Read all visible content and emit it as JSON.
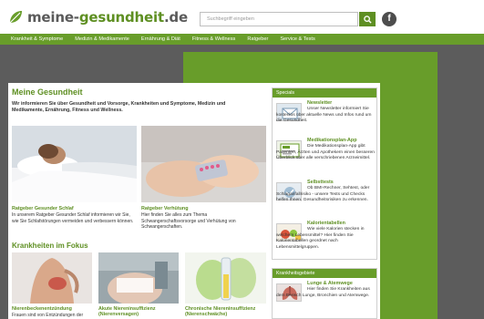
{
  "header": {
    "logo": {
      "prefix": "meine-",
      "highlight": "gesundheit",
      "suffix": ".de"
    },
    "search": {
      "placeholder": "Suchbegriff eingeben"
    },
    "search_icon": "search-icon",
    "social_icon": "facebook-icon",
    "social_label": "f"
  },
  "nav": {
    "items": [
      "Krankheit & Symptome",
      "Medizin & Medikamente",
      "Ernährung & Diät",
      "Fitness & Wellness",
      "Ratgeber",
      "Service & Tests"
    ]
  },
  "main": {
    "title": "Meine Gesundheit",
    "intro": "Wir informieren Sie über Gesundheit und Vorsorge, Krankheiten und Symptome, Medizin und Medikamente, Ernährung, Fitness und Wellness.",
    "cards": [
      {
        "title": "Ratgeber Gesunder Schlaf",
        "desc": "In unserem Ratgeber Gesunder Schlaf informieren wir Sie, wie Sie Schlafstörungen vermeiden und verbessern können."
      },
      {
        "title": "Ratgeber Verhütung",
        "desc": "Hier finden Sie alles zum Thema Schwangerschaftsvorsorge und Verhütung von Schwangerschaften."
      }
    ],
    "focus_heading": "Krankheiten im Fokus",
    "focus_items": [
      {
        "title": "Nierenbeckenentzündung",
        "desc": "Frauen sind von Entzündungen der"
      },
      {
        "title": "Akute Niereninsuffizienz (Nierenversagen)"
      },
      {
        "title": "Chronische Niereninsuffizienz (Nierenschwäche)"
      }
    ]
  },
  "sidebar": {
    "specials_heading": "Specials",
    "specials": [
      {
        "title": "Newsletter",
        "text": "Unser Newsletter informiert Sie kostenlos über aktuelle News und Infos rund um die Gesundheit."
      },
      {
        "title": "Medikationsplan-App",
        "text": "Die Medikationsplan-App gibt Patienten, Ärzten und Apothekern einen besseren Überblick über alle verschriebenen Arzneimittel."
      },
      {
        "title": "Selbsttests",
        "text": "Ob BMI-Rechner, Sehtest, oder Schlaganfallrisiko - unsere Tests und Checks helfen Ihnen, Gesundheitsrisiken zu erkennen."
      },
      {
        "title": "Kalorientabellen",
        "text": "Wie viele Kalorien stecken in welchem Lebensmittel? Hier finden Sie Kalorientabellen geordnet nach Lebensmittelgruppen."
      }
    ],
    "areas_heading": "Krankheitsgebiete",
    "areas": [
      {
        "title": "Lunge & Atemwege",
        "text": "Hier finden Sie Krankheiten aus dem Bereich Lunge, Bronchien und Atemwege."
      }
    ]
  },
  "colors": {
    "brand_green": "#689d2a",
    "logo_green": "#5e8f22",
    "backdrop_gray": "#5c5c5c"
  }
}
